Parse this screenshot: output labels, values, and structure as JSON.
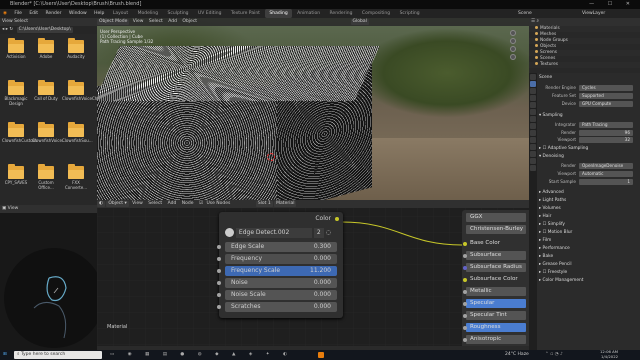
{
  "window": {
    "title": "Blender* [C:\\Users\\User\\Desktop\\Brush\\Brush.blend]",
    "controls": "— ☐ ✕"
  },
  "menu": {
    "items": [
      "File",
      "Edit",
      "Render",
      "Window",
      "Help"
    ],
    "workspaces": [
      "Layout",
      "Modeling",
      "Sculpting",
      "UV Editing",
      "Texture Paint",
      "Shading",
      "Animation",
      "Rendering",
      "Compositing",
      "Scripting"
    ],
    "active_workspace": "Shading",
    "scene": "Scene",
    "view_layer": "ViewLayer"
  },
  "filebrowser": {
    "header": "View  Select",
    "path": "C:\\Users\\User\\Desktop\\",
    "folders": [
      "Activision",
      "Adobe",
      "Audacity",
      "Blackmagic Design",
      "Call of Duty",
      "ClownfishVoiceCh...",
      "ClownfishCustom",
      "ClownfishVoice...",
      "ClownfishSou...",
      "CPY_SAVES",
      "Custom Office...",
      "FXX Convertе..."
    ]
  },
  "viewport": {
    "mode": "Object Mode",
    "menus": [
      "View",
      "Select",
      "Add",
      "Object"
    ],
    "overlay_lines": [
      "User Perspective",
      "(1) Collection | Cube",
      "Path Tracing Sample 1/32"
    ],
    "shading": "Global"
  },
  "outliner": {
    "rows": [
      "Materials",
      "Meshes",
      "Node Groups",
      "Objects",
      "Screens",
      "Scenes",
      "Textures"
    ]
  },
  "properties": {
    "header": "Scene",
    "rows": [
      {
        "label": "Render Engine",
        "value": "Cycles"
      },
      {
        "label": "Feature Set",
        "value": "Supported"
      },
      {
        "label": "Device",
        "value": "GPU Compute"
      }
    ],
    "sampling_header": "Sampling",
    "sampling": [
      {
        "label": "Integrator",
        "value": "Path Tracing"
      },
      {
        "label": "Render",
        "value": "96"
      },
      {
        "label": "Viewport",
        "value": "32"
      }
    ],
    "adaptive": "Adaptive Sampling",
    "denoising": "Denoising",
    "denoise_rows": [
      {
        "label": "Render",
        "value": "OpenImageDenoise"
      },
      {
        "label": "Viewport",
        "value": "Automatic"
      },
      {
        "label": "Start Sample",
        "value": "1"
      }
    ],
    "sections": [
      "Advanced",
      "Light Paths",
      "Volumes",
      "Hair",
      "Simplify",
      "Motion Blur",
      "Film",
      "Performance",
      "Bake",
      "Grease Pencil",
      "Freestyle",
      "Color Management"
    ]
  },
  "nodeeditor": {
    "header_menus": [
      "View",
      "Select",
      "Add",
      "Node"
    ],
    "use_nodes": "Use Nodes",
    "slot": "Slot 1",
    "material": "Material",
    "label": "Material",
    "node": {
      "output": "Color",
      "texture": "Edge Detect.002",
      "users": "2",
      "fields": [
        {
          "label": "Edge Scale",
          "value": "0.300"
        },
        {
          "label": "Frequency",
          "value": "0.000"
        },
        {
          "label": "Frequency Scale",
          "value": "11.200"
        },
        {
          "label": "Noise",
          "value": "0.000"
        },
        {
          "label": "Noise Scale",
          "value": "0.000"
        },
        {
          "label": "Scratches",
          "value": "0.000"
        }
      ]
    },
    "bsdf": {
      "rows": [
        "GGX",
        "Christensen-Burley",
        "Base Color",
        "Subsurface",
        "Subsurface Radius",
        "Subsurface Color",
        "Metallic",
        "Specular",
        "Specular Tint",
        "Roughness",
        "Anisotropic"
      ]
    }
  },
  "taskbar": {
    "search": "Type here to search",
    "weather": "24°C  Haze",
    "time": "12:06 AM",
    "date": "1/4/2022"
  }
}
